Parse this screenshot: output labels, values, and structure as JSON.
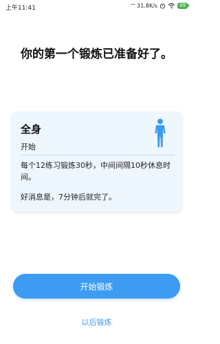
{
  "status_bar": {
    "time": "上午11:41",
    "network_speed": "31.8K/s",
    "battery": "89"
  },
  "headline": "你的第一个锻炼已准备好了。",
  "card": {
    "title": "全身",
    "subtitle": "开始",
    "icon": "body-figure-icon",
    "description": "每个12练习锻炼30秒，中间间隔10秒休息时间。",
    "note": "好消息是，7分钟后就完了。"
  },
  "actions": {
    "start_label": "开始锻炼",
    "later_label": "以后锻炼"
  },
  "colors": {
    "accent": "#3d9bf2",
    "card_bg": "#eef6fe",
    "battery": "#4caf50"
  }
}
